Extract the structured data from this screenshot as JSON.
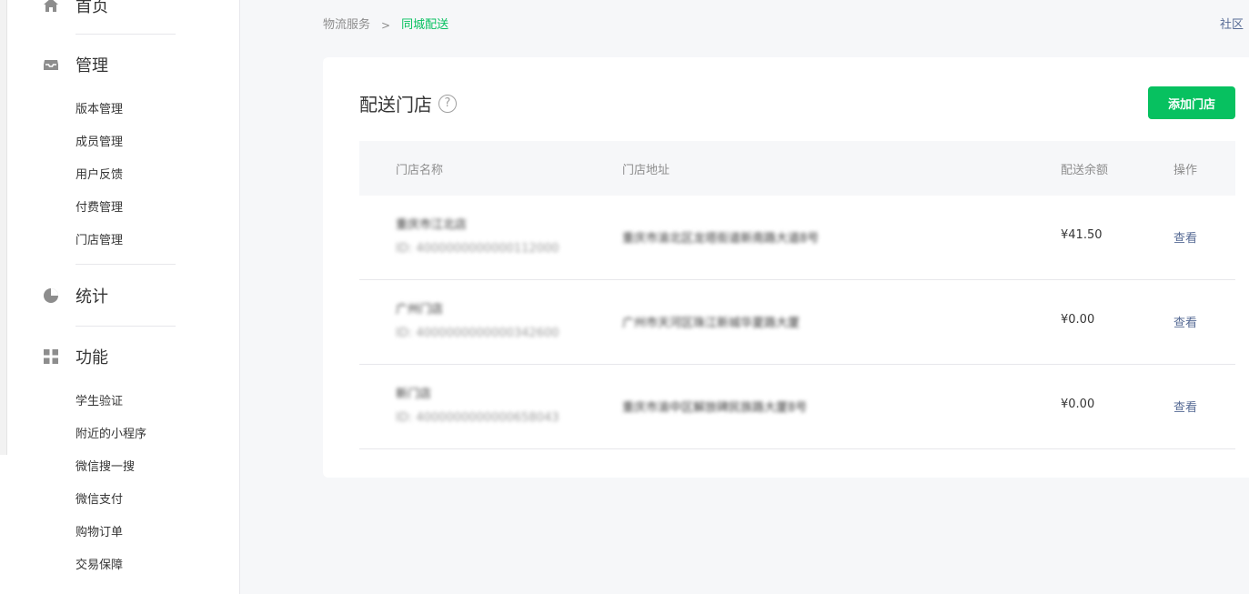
{
  "sidebar": {
    "home": {
      "label": "首页"
    },
    "groups": [
      {
        "label": "管理",
        "icon": "inbox-icon",
        "items": [
          "版本管理",
          "成员管理",
          "用户反馈",
          "付费管理",
          "门店管理"
        ]
      },
      {
        "label": "统计",
        "icon": "pie-chart-icon",
        "items": []
      },
      {
        "label": "功能",
        "icon": "grid-icon",
        "items": [
          "学生验证",
          "附近的小程序",
          "微信搜一搜",
          "微信支付",
          "购物订单",
          "交易保障"
        ]
      }
    ]
  },
  "breadcrumb": {
    "parent": "物流服务",
    "separator": ">",
    "current": "同城配送"
  },
  "header": {
    "community": "社区"
  },
  "card": {
    "title": "配送门店",
    "help_icon": "?",
    "add_button": "添加门店"
  },
  "table": {
    "columns": [
      "门店名称",
      "门店地址",
      "配送余额",
      "操作"
    ],
    "rows": [
      {
        "name": "重庆市江北店",
        "id": "ID: 4000000000000112000",
        "address": "重庆市渝北区龙塔街道新南路大道8号",
        "balance": "¥41.50",
        "action": "查看"
      },
      {
        "name": "广州门店",
        "id": "ID: 4000000000000342600",
        "address": "广州市天河区珠江新城华夏路大厦",
        "balance": "¥0.00",
        "action": "查看"
      },
      {
        "name": "新门店",
        "id": "ID: 4000000000000658043",
        "address": "重庆市渝中区解放碑民族路大厦8号",
        "balance": "¥0.00",
        "action": "查看"
      }
    ]
  },
  "colors": {
    "accent": "#07c160",
    "link": "#576b95"
  }
}
